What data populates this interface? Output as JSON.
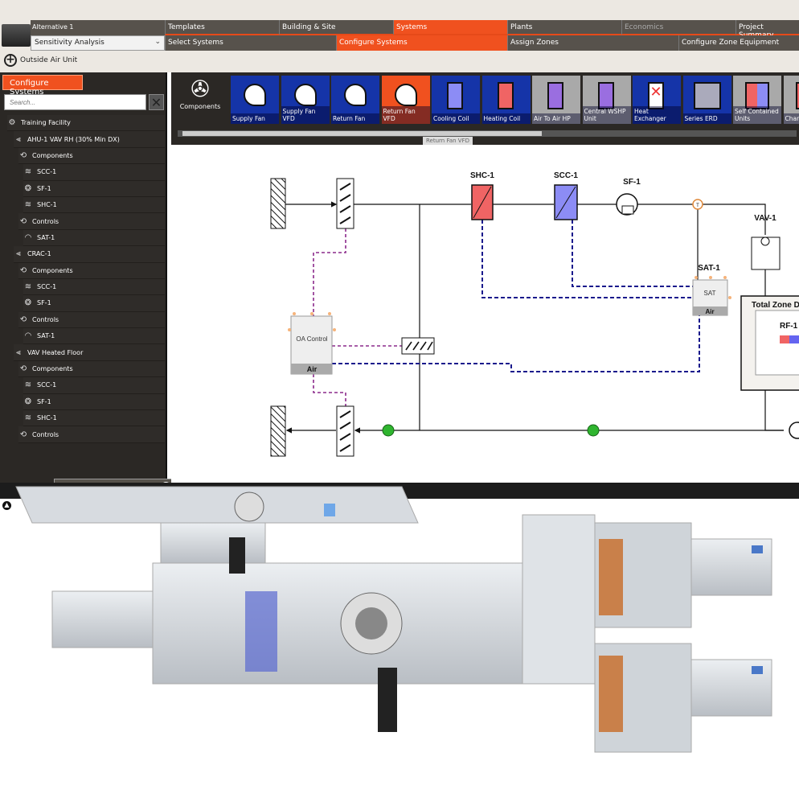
{
  "header": {
    "alternative": "Alternative 1",
    "analysis_select": "Sensitivity Analysis",
    "main_tabs": [
      {
        "label": "Templates"
      },
      {
        "label": "Building & Site"
      },
      {
        "label": "Systems",
        "active": true
      },
      {
        "label": "Plants"
      },
      {
        "label": "Economics",
        "disabled": true
      },
      {
        "label": "Project Summary"
      }
    ],
    "sub_tabs": [
      {
        "label": "Select Systems"
      },
      {
        "label": "Configure Systems",
        "active": true
      },
      {
        "label": "Assign Zones"
      },
      {
        "label": "Configure Zone Equipment"
      }
    ],
    "add_button": "Outside Air Unit"
  },
  "sidebar": {
    "tab": "Configure Systems",
    "search_placeholder": "Search...",
    "tree": [
      {
        "label": "Training Facility",
        "icon": "building-icon",
        "level": 0
      },
      {
        "label": "AHU-1 VAV RH (30% Min DX)",
        "icon": "system-icon",
        "level": 1
      },
      {
        "label": "Components",
        "icon": "loop-icon",
        "level": 2
      },
      {
        "label": "SCC-1",
        "icon": "cooling-coil-icon",
        "level": 3
      },
      {
        "label": "SF-1",
        "icon": "fan-icon",
        "level": 3
      },
      {
        "label": "SHC-1",
        "icon": "heating-coil-icon",
        "level": 3
      },
      {
        "label": "Controls",
        "icon": "loop-icon",
        "level": 2
      },
      {
        "label": "SAT-1",
        "icon": "gauge-icon",
        "level": 3
      },
      {
        "label": "CRAC-1",
        "icon": "system-icon",
        "level": 1
      },
      {
        "label": "Components",
        "icon": "loop-icon",
        "level": 2
      },
      {
        "label": "SCC-1",
        "icon": "cooling-coil-icon",
        "level": 3
      },
      {
        "label": "SF-1",
        "icon": "fan-icon",
        "level": 3
      },
      {
        "label": "Controls",
        "icon": "loop-icon",
        "level": 2
      },
      {
        "label": "SAT-1",
        "icon": "gauge-icon",
        "level": 3
      },
      {
        "label": "VAV Heated Floor",
        "icon": "system-icon",
        "level": 1
      },
      {
        "label": "Components",
        "icon": "loop-icon",
        "level": 2
      },
      {
        "label": "SCC-1",
        "icon": "cooling-coil-icon",
        "level": 3
      },
      {
        "label": "SF-1",
        "icon": "fan-icon",
        "level": 3
      },
      {
        "label": "SHC-1",
        "icon": "heating-coil-icon",
        "level": 3
      },
      {
        "label": "Controls",
        "icon": "loop-icon",
        "level": 2
      },
      {
        "label": "SAT-1",
        "icon": "gauge-icon",
        "level": 3,
        "selected": true
      }
    ]
  },
  "components": {
    "title": "Components",
    "tooltip": "Return Fan VFD",
    "items": [
      {
        "label": "Supply Fan",
        "kind": "fan"
      },
      {
        "label": "Supply Fan VFD",
        "kind": "fan"
      },
      {
        "label": "Return Fan",
        "kind": "fan"
      },
      {
        "label": "Return Fan VFD",
        "kind": "fan",
        "active": true
      },
      {
        "label": "Cooling Coil",
        "kind": "cool"
      },
      {
        "label": "Heating Coil",
        "kind": "heat"
      },
      {
        "label": "Air To Air HP",
        "kind": "hp",
        "gray": true
      },
      {
        "label": "Central WSHP Unit",
        "kind": "hp",
        "gray": true
      },
      {
        "label": "Heat Exchanger",
        "kind": "hx"
      },
      {
        "label": "Series ERD",
        "kind": "erd"
      },
      {
        "label": "Self Contained Units",
        "kind": "sc",
        "gray": true
      },
      {
        "label": "Chan Bypas",
        "kind": "sc",
        "gray": true
      }
    ]
  },
  "diagram": {
    "shc": "SHC-1",
    "scc": "SCC-1",
    "sf": "SF-1",
    "vav": "VAV-1",
    "sat_label": "SAT-1",
    "sat_box": "SAT",
    "air": "Air",
    "oa": "OA Control",
    "zone": "Total Zone D",
    "rf": "RF-1",
    "sensor": "T"
  },
  "colors": {
    "accent": "#f0511f",
    "component_blue": "#1534a8",
    "cool": "#8c8cf5",
    "heat": "#f06464",
    "control_dash": "#8b2a8b",
    "water_dash": "#1a1a8c",
    "node_green": "#2fb52f"
  }
}
